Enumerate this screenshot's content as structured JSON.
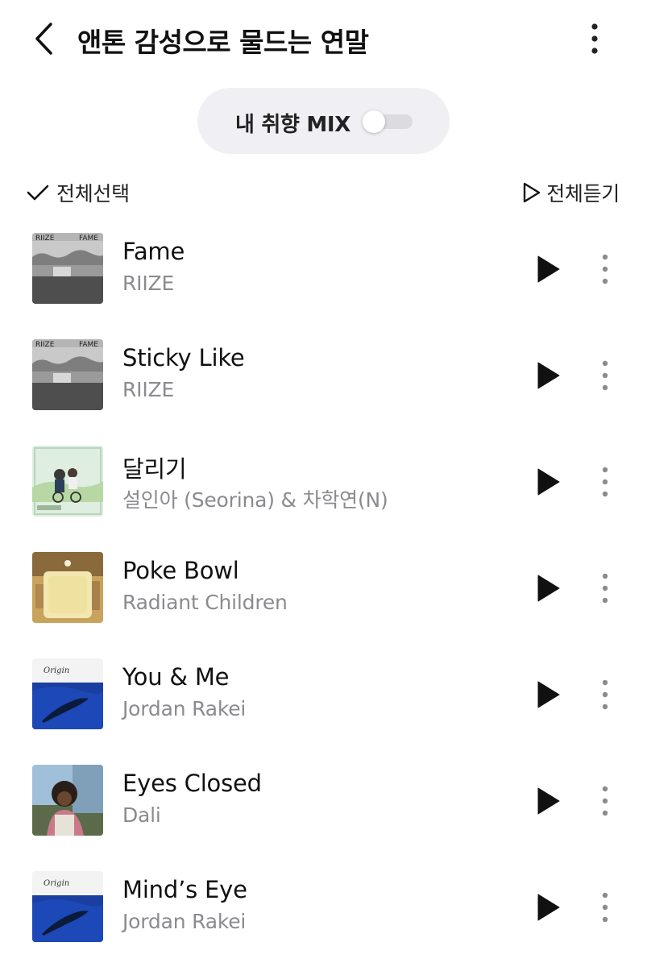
{
  "header": {
    "title": "앤톤 감성으로 물드는 연말"
  },
  "mix": {
    "label": "내 취향 MIX",
    "enabled": false
  },
  "toolbar": {
    "select_all_label": "전체선택",
    "play_all_label": "전체듣기"
  },
  "tracks": [
    {
      "title": "Fame",
      "artist": "RIIZE",
      "cover": "riize-fame-cover"
    },
    {
      "title": "Sticky Like",
      "artist": "RIIZE",
      "cover": "riize-fame-cover"
    },
    {
      "title": "달리기",
      "artist": "설인아 (Seorina) & 차학연(N)",
      "cover": "dalligi-cover"
    },
    {
      "title": "Poke Bowl",
      "artist": "Radiant Children",
      "cover": "poke-bowl-cover"
    },
    {
      "title": "You & Me",
      "artist": "Jordan Rakei",
      "cover": "origin-cover"
    },
    {
      "title": "Eyes Closed",
      "artist": "Dali",
      "cover": "eyes-closed-cover"
    },
    {
      "title": "Mind’s Eye",
      "artist": "Jordan Rakei",
      "cover": "origin-cover"
    }
  ],
  "colors": {
    "pill_bg": "#f0f0f4",
    "artist_text": "#8b8b8f",
    "toggle_track": "#dcdce0"
  },
  "icons": {
    "back": "chevron-left-icon",
    "more": "vertical-ellipsis-icon",
    "check": "checkmark-icon",
    "play_outline": "play-outline-icon",
    "play": "play-icon"
  }
}
